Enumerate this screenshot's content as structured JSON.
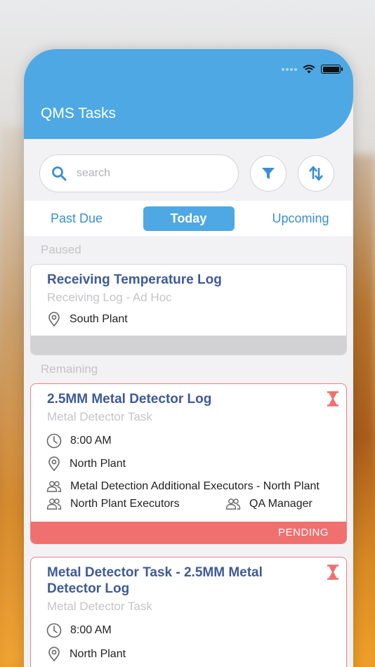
{
  "app": {
    "title": "QMS Tasks"
  },
  "search": {
    "placeholder": "search"
  },
  "tabs": [
    {
      "label": "Past Due",
      "active": false
    },
    {
      "label": "Today",
      "active": true
    },
    {
      "label": "Upcoming",
      "active": false
    }
  ],
  "sections": {
    "paused": "Paused",
    "remaining": "Remaining"
  },
  "tasks": [
    {
      "title": "Receiving Temperature Log",
      "subtitle": "Receiving Log - Ad Hoc",
      "location": "South Plant"
    },
    {
      "title": "2.5MM Metal Detector Log",
      "subtitle": "Metal Detector Task",
      "time": "8:00 AM",
      "location": "North Plant",
      "assignees": [
        "Metal Detection Additional Executors - North Plant",
        "North Plant Executors",
        "QA Manager"
      ],
      "status": "PENDING"
    },
    {
      "title": "Metal Detector Task - 2.5MM Metal Detector Log",
      "subtitle": "Metal Detector Task",
      "time": "8:00 AM",
      "location": "North Plant"
    }
  ],
  "colors": {
    "header": "#4ea8e3",
    "title_text": "#3f5a98",
    "pending": "#f06f6f",
    "tab_text": "#3a8fd0"
  },
  "icons": [
    "search-icon",
    "filter-icon",
    "sort-icon",
    "location-pin-icon",
    "clock-icon",
    "people-icon",
    "hourglass-icon",
    "wifi-icon",
    "battery-icon"
  ]
}
